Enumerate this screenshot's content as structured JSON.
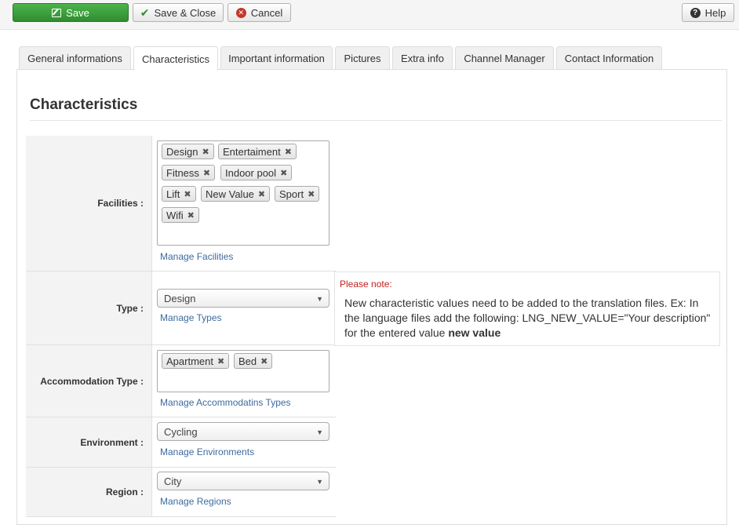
{
  "toolbar": {
    "save_label": "Save",
    "save_close_label": "Save & Close",
    "cancel_label": "Cancel",
    "help_label": "Help"
  },
  "tabs": [
    {
      "label": "General informations"
    },
    {
      "label": "Characteristics",
      "active": true
    },
    {
      "label": "Important information"
    },
    {
      "label": "Pictures"
    },
    {
      "label": "Extra info"
    },
    {
      "label": "Channel Manager"
    },
    {
      "label": "Contact Information"
    }
  ],
  "section_title": "Characteristics",
  "facilities": {
    "label": "Facilities :",
    "chips": [
      "Design",
      "Entertaiment",
      "Fitness",
      "Indoor pool",
      "Lift",
      "New Value",
      "Sport",
      "Wifi"
    ],
    "manage_link": "Manage Facilities"
  },
  "type": {
    "label": "Type :",
    "selected": "Design",
    "manage_link": "Manage Types"
  },
  "note": {
    "heading": "Please note:",
    "text": "New characteristic values need to be added to the translation files. Ex: In the language files add the following: LNG_NEW_VALUE=\"Your description\" for the entered value",
    "emphasis": "new value"
  },
  "accommodation_type": {
    "label": "Accommodation Type :",
    "chips": [
      "Apartment",
      "Bed"
    ],
    "manage_link": "Manage Accommodatins Types"
  },
  "environment": {
    "label": "Environment :",
    "selected": "Cycling",
    "manage_link": "Manage Environments"
  },
  "region": {
    "label": "Region :",
    "selected": "City",
    "manage_link": "Manage Regions"
  },
  "colors": {
    "save_button": "#3a9d3a",
    "link": "#3d6a9e",
    "note_heading": "#c41e1e"
  }
}
